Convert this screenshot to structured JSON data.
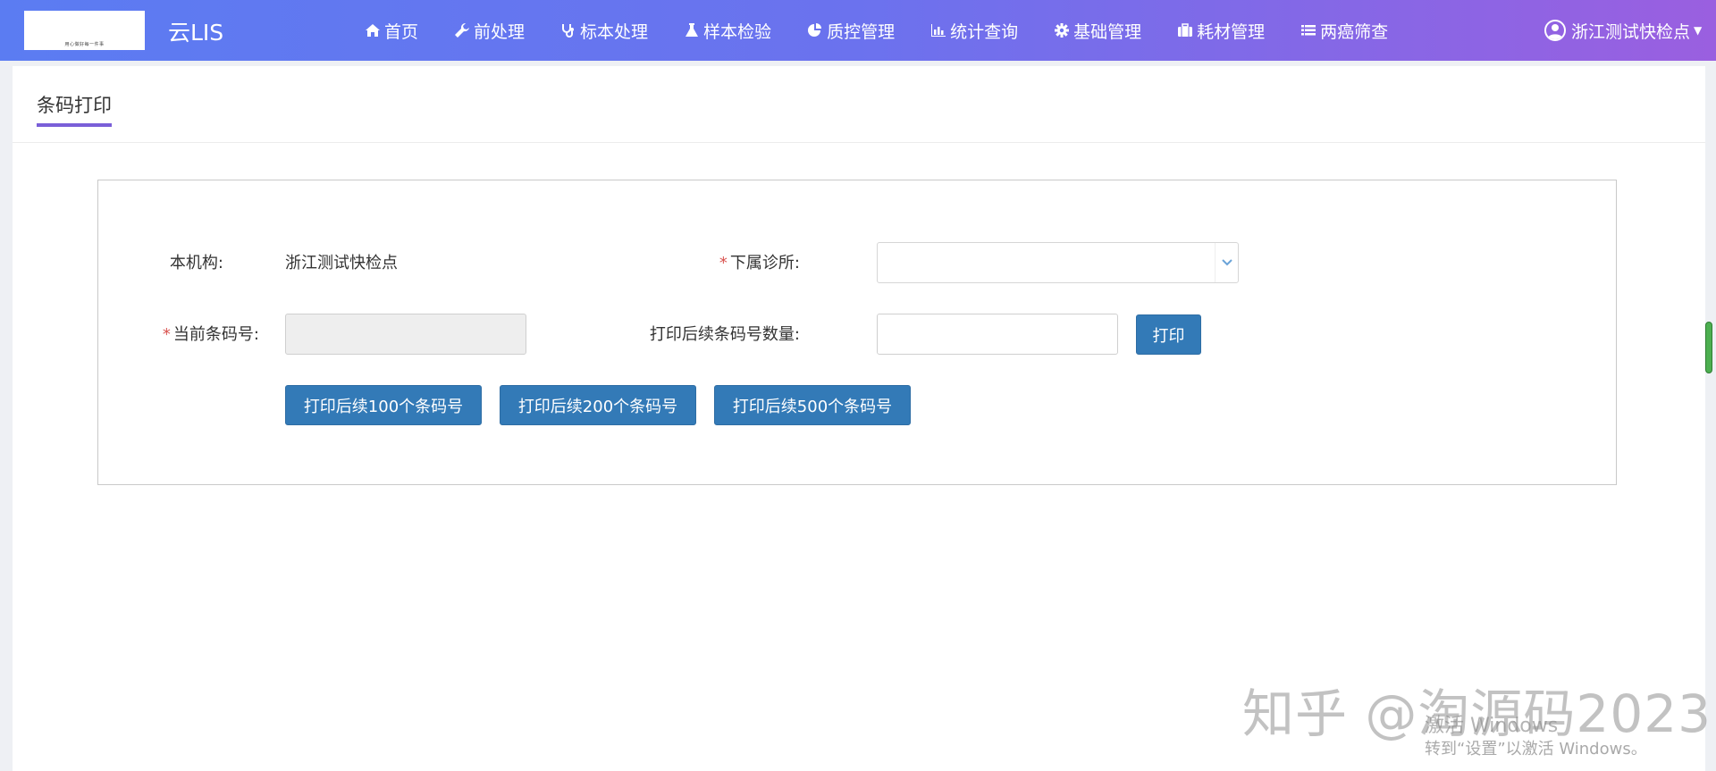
{
  "header": {
    "logo_text": "用心做好每一件事",
    "app_title": "云LIS",
    "nav": [
      {
        "label": "首页",
        "icon": "home-icon"
      },
      {
        "label": "前处理",
        "icon": "wrench-icon"
      },
      {
        "label": "标本处理",
        "icon": "stethoscope-icon"
      },
      {
        "label": "样本检验",
        "icon": "flask-icon"
      },
      {
        "label": "质控管理",
        "icon": "pie-chart-icon"
      },
      {
        "label": "统计查询",
        "icon": "bar-chart-icon"
      },
      {
        "label": "基础管理",
        "icon": "gear-icon"
      },
      {
        "label": "耗材管理",
        "icon": "briefcase-icon"
      },
      {
        "label": "两癌筛查",
        "icon": "list-icon"
      }
    ],
    "user": "浙江测试快检点"
  },
  "tab": {
    "active_label": "条码打印"
  },
  "form": {
    "org_label": "本机构:",
    "org_value": "浙江测试快检点",
    "clinic_label": "下属诊所:",
    "clinic_value": "",
    "barcode_label": "当前条码号:",
    "barcode_value": "",
    "count_label": "打印后续条码号数量:",
    "count_value": "",
    "print_button": "打印",
    "print100_button": "打印后续100个条码号",
    "print200_button": "打印后续200个条码号",
    "print500_button": "打印后续500个条码号",
    "required_mark": "*"
  },
  "watermark": {
    "zhihu": "知乎 @淘源码2023",
    "activate_line1": "激活 Windows",
    "activate_line2": "转到“设置”以激活 Windows。"
  },
  "colors": {
    "header_gradient_start": "#5b7cf2",
    "header_gradient_end": "#9a5fe0",
    "button_primary": "#337ab7",
    "tab_underline": "#7a5fd8",
    "required": "#d9534f"
  }
}
